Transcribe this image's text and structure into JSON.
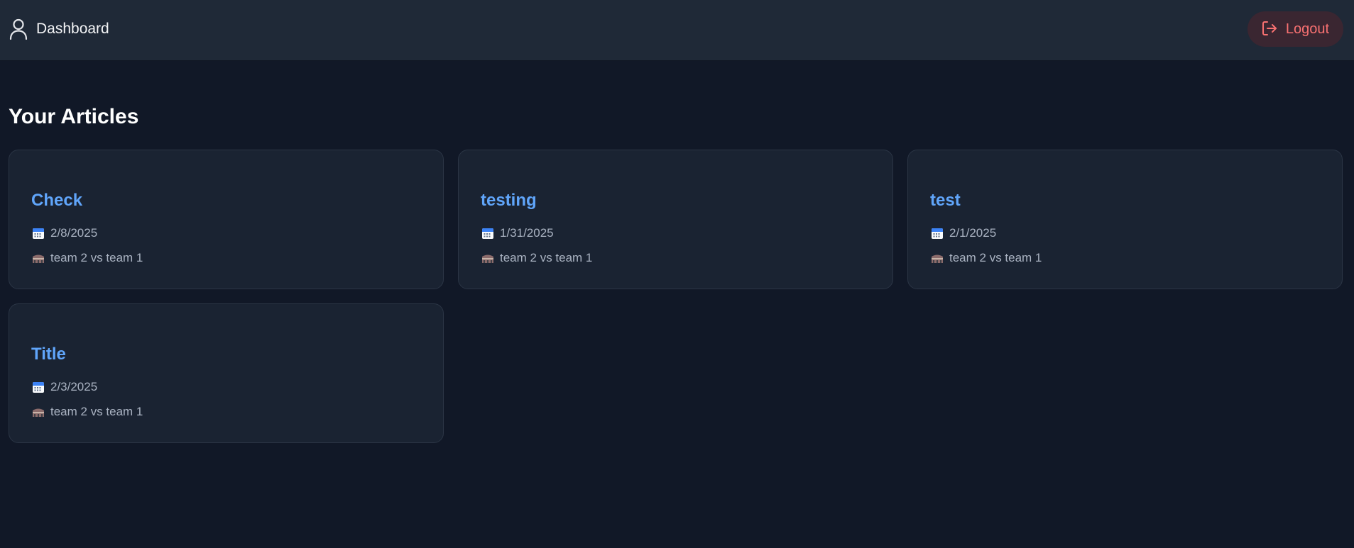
{
  "header": {
    "title": "Dashboard",
    "logout_label": "Logout",
    "user_icon": "user-icon",
    "logout_icon": "logout-icon"
  },
  "main": {
    "section_title": "Your Articles",
    "articles": [
      {
        "title": "Check",
        "date": "2/8/2025",
        "match": "team 2 vs team 1"
      },
      {
        "title": "testing",
        "date": "1/31/2025",
        "match": "team 2 vs team 1"
      },
      {
        "title": "test",
        "date": "2/1/2025",
        "match": "team 2 vs team 1"
      },
      {
        "title": "Title",
        "date": "2/3/2025",
        "match": "team 2 vs team 1"
      }
    ]
  },
  "colors": {
    "background": "#111827",
    "header": "#1f2937",
    "card": "#1a2332",
    "accent": "#60a5fa",
    "logout": "#f87171"
  }
}
